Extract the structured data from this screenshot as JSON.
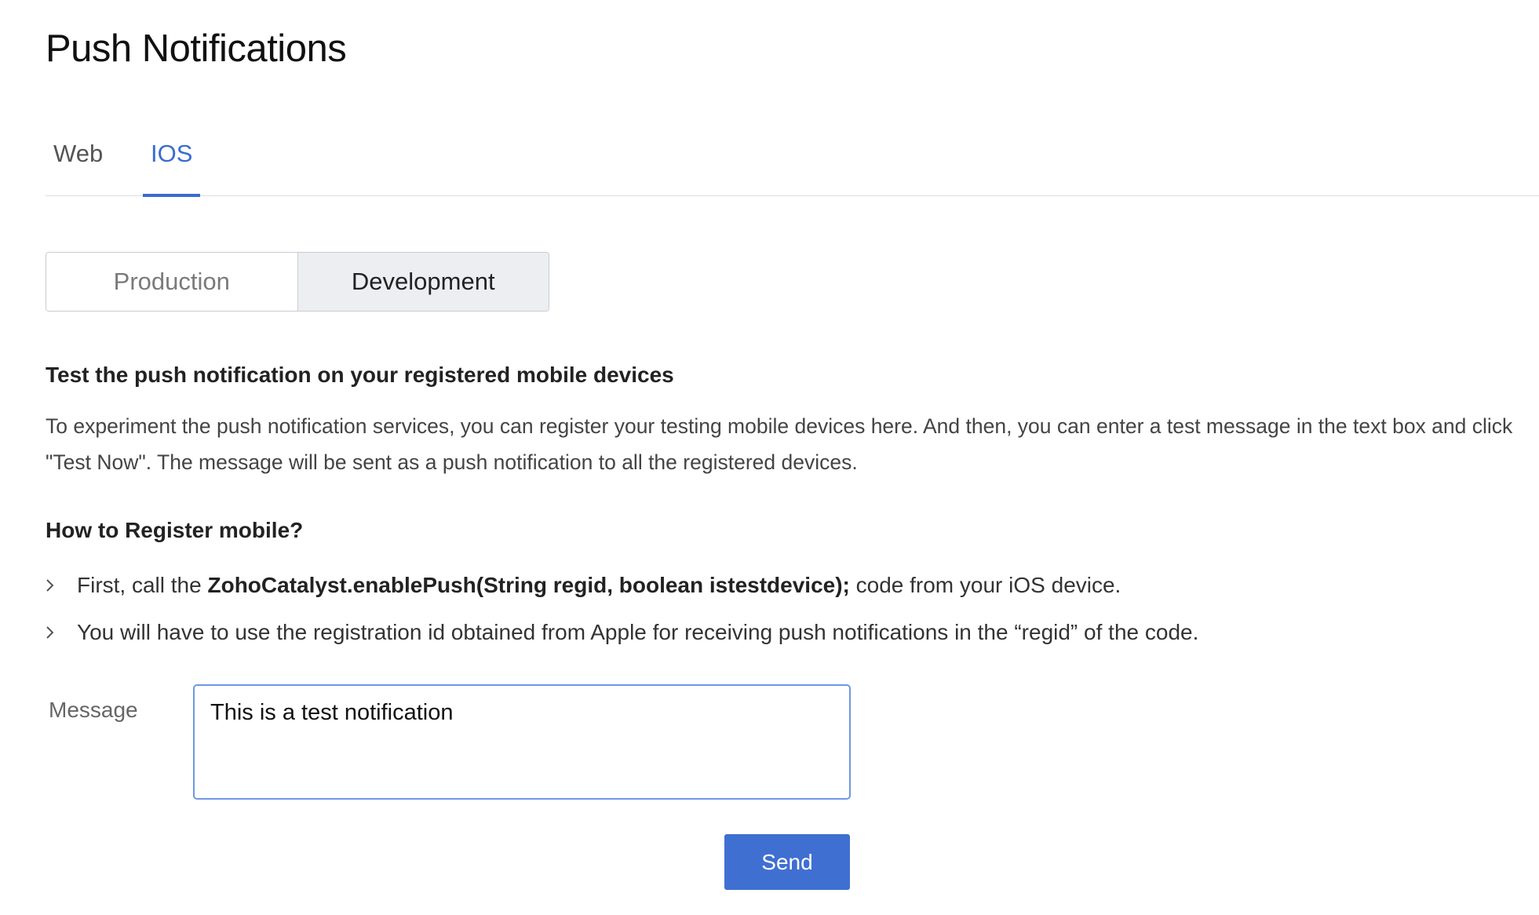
{
  "page": {
    "title": "Push Notifications"
  },
  "tabs": [
    {
      "label": "Web",
      "active": false
    },
    {
      "label": "IOS",
      "active": true
    }
  ],
  "environment_toggle": {
    "options": [
      "Production",
      "Development"
    ],
    "selected": "Development"
  },
  "test_section": {
    "heading": "Test the push notification on your registered mobile devices",
    "description": "To experiment the push notification services, you can register your testing mobile devices here. And then, you can enter a test message in the text box and click \"Test Now\". The message will be sent as a push notification to all the registered devices."
  },
  "register_section": {
    "heading": "How to Register mobile?",
    "steps": [
      {
        "prefix": "First, call the ",
        "code": "ZohoCatalyst.enablePush(String regid, boolean istestdevice);",
        "suffix": " code from your iOS device."
      },
      {
        "prefix": "You will have to use the registration id obtained from Apple for receiving push notifications in the “regid” of the code.",
        "code": "",
        "suffix": ""
      }
    ]
  },
  "message_form": {
    "label": "Message",
    "value": "This is a test notification",
    "send_label": "Send"
  },
  "colors": {
    "accent": "#3b6bd1",
    "button": "#3f6fd1",
    "selected_segment": "#eceef1",
    "input_focus_border": "#6e97e6"
  },
  "icons": {
    "step_bullet": "chevron-right-icon"
  }
}
